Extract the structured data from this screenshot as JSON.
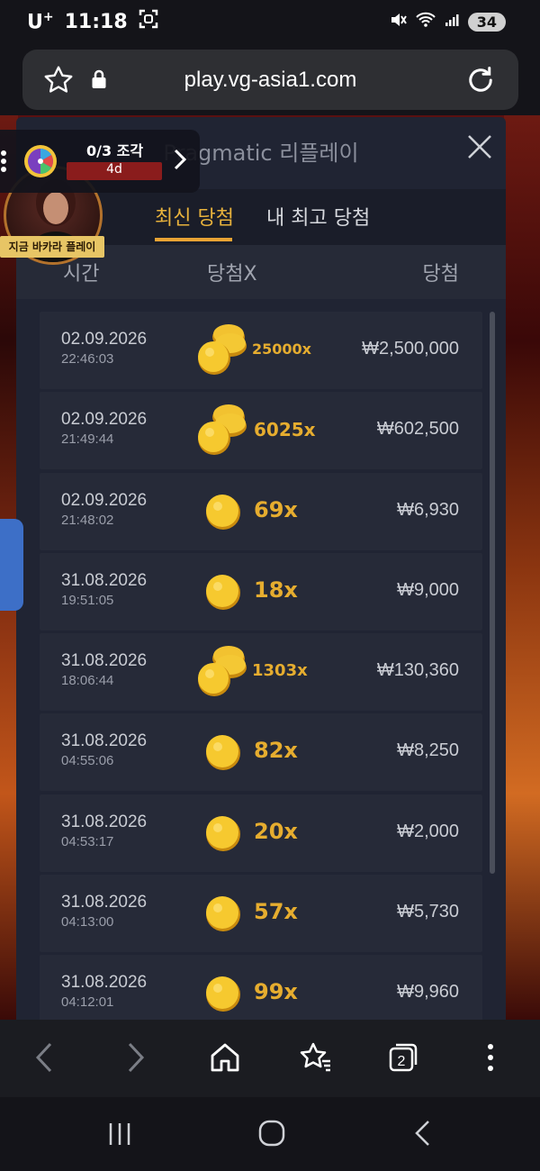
{
  "status_bar": {
    "carrier": "U",
    "carrier_sup": "+",
    "time": "11:18",
    "battery": "34"
  },
  "browser": {
    "url": "play.vg-asia1.com"
  },
  "banner": {
    "progress": "0/3 조각",
    "days": "4d"
  },
  "avatar": {
    "label": "지금 바카라 플레이"
  },
  "modal": {
    "title": "Pragmatic 리플레이",
    "tabs": [
      {
        "label": "최신 당첨",
        "active": true
      },
      {
        "label": "내 최고 당첨",
        "active": false
      }
    ],
    "columns": {
      "time": "시간",
      "multiplier": "당첨X",
      "win": "당첨"
    },
    "rows": [
      {
        "date": "02.09.2026",
        "time": "22:46:03",
        "multiplier": "25000x",
        "win": "₩2,500,000",
        "coin": "stack"
      },
      {
        "date": "02.09.2026",
        "time": "21:49:44",
        "multiplier": "6025x",
        "win": "₩602,500",
        "coin": "stack"
      },
      {
        "date": "02.09.2026",
        "time": "21:48:02",
        "multiplier": "69x",
        "win": "₩6,930",
        "coin": "single"
      },
      {
        "date": "31.08.2026",
        "time": "19:51:05",
        "multiplier": "18x",
        "win": "₩9,000",
        "coin": "single"
      },
      {
        "date": "31.08.2026",
        "time": "18:06:44",
        "multiplier": "1303x",
        "win": "₩130,360",
        "coin": "stack"
      },
      {
        "date": "31.08.2026",
        "time": "04:55:06",
        "multiplier": "82x",
        "win": "₩8,250",
        "coin": "single"
      },
      {
        "date": "31.08.2026",
        "time": "04:53:17",
        "multiplier": "20x",
        "win": "₩2,000",
        "coin": "single"
      },
      {
        "date": "31.08.2026",
        "time": "04:13:00",
        "multiplier": "57x",
        "win": "₩5,730",
        "coin": "single"
      },
      {
        "date": "31.08.2026",
        "time": "04:12:01",
        "multiplier": "99x",
        "win": "₩9,960",
        "coin": "single"
      }
    ]
  },
  "bottom_nav": {
    "tab_count": "2"
  },
  "colors": {
    "accent": "#e8a334",
    "modal_bg": "#202433",
    "row_bg": "#262a38"
  }
}
